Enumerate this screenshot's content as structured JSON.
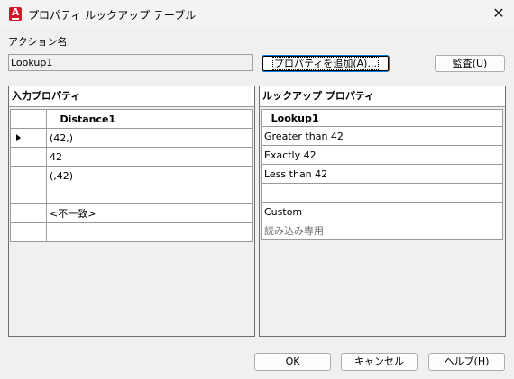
{
  "window": {
    "title": "プロパティ ルックアップ テーブル",
    "close_glyph": "✕",
    "icon": "autocad-a-icon"
  },
  "action": {
    "label": "アクション名:",
    "value": "Lookup1"
  },
  "buttons": {
    "add_property": "プロパティを追加(A)...",
    "audit": "監査(U)",
    "ok": "OK",
    "cancel": "キャンセル",
    "help": "ヘルプ(H)"
  },
  "input_panel": {
    "title": "入力プロパティ",
    "column": "Distance1",
    "rows": [
      "(42,)",
      "42",
      "(,42)",
      "",
      "<不一致>",
      ""
    ]
  },
  "lookup_panel": {
    "title": "ルックアップ プロパティ",
    "column": "Lookup1",
    "rows": [
      "Greater than 42",
      "Exactly 42",
      "Less than 42",
      "",
      "Custom",
      "読み込み専用"
    ]
  },
  "selected_row_index": 0
}
